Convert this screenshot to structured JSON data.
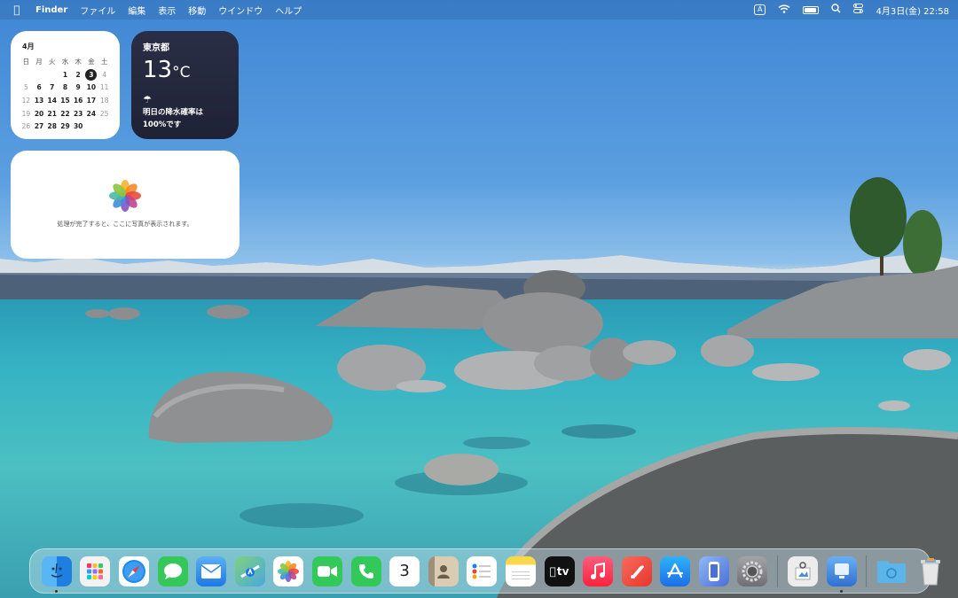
{
  "menubar": {
    "apple_icon": "apple-logo-icon",
    "app_name": "Finder",
    "menus": [
      "ファイル",
      "編集",
      "表示",
      "移動",
      "ウインドウ",
      "ヘルプ"
    ],
    "input_source": "A",
    "status_icons": [
      "wifi-icon",
      "battery-icon",
      "spotlight-icon",
      "control-center-icon"
    ],
    "clock": "4月3日(金)  22:58"
  },
  "calendar_widget": {
    "month": "4月",
    "weekdays": [
      "日",
      "月",
      "火",
      "水",
      "木",
      "金",
      "土"
    ],
    "weeks": [
      [
        "",
        "",
        "",
        "1",
        "2",
        "3",
        "4"
      ],
      [
        "5",
        "6",
        "7",
        "8",
        "9",
        "10",
        "11"
      ],
      [
        "12",
        "13",
        "14",
        "15",
        "16",
        "17",
        "18"
      ],
      [
        "19",
        "20",
        "21",
        "22",
        "23",
        "24",
        "25"
      ],
      [
        "26",
        "27",
        "28",
        "29",
        "30",
        "",
        ""
      ]
    ],
    "today": "3"
  },
  "weather_widget": {
    "location": "東京都",
    "temperature": "13",
    "unit": "°C",
    "icon": "umbrella-icon",
    "forecast_line1": "明日の降水確率は",
    "forecast_line2": "100%です"
  },
  "photos_widget": {
    "icon": "photos-icon",
    "message": "処理が完了すると、ここに写真が表示されます。"
  },
  "dock": {
    "apps": [
      {
        "name": "finder",
        "icon": "finder-icon",
        "color": "#2f8de4",
        "running": true
      },
      {
        "name": "launchpad",
        "icon": "launchpad-icon",
        "color": "#f2f2f2",
        "running": false
      },
      {
        "name": "safari",
        "icon": "safari-icon",
        "color": "#1a8cf0",
        "running": false
      },
      {
        "name": "messages",
        "icon": "messages-icon",
        "color": "#35c759",
        "running": false
      },
      {
        "name": "mail",
        "icon": "mail-icon",
        "color": "#3b95f0",
        "running": false
      },
      {
        "name": "maps",
        "icon": "maps-icon",
        "color": "#4fbf6a",
        "running": false
      },
      {
        "name": "photos",
        "icon": "photos-icon",
        "color": "#ffffff",
        "running": false
      },
      {
        "name": "facetime",
        "icon": "facetime-icon",
        "color": "#33c85a",
        "running": false
      },
      {
        "name": "phone",
        "icon": "phone-icon",
        "color": "#33c85a",
        "running": false
      },
      {
        "name": "calendar",
        "icon": "calendar-icon",
        "color": "#ffffff",
        "label": "3",
        "running": false
      },
      {
        "name": "contacts",
        "icon": "contacts-icon",
        "color": "#c8b89a",
        "running": false
      },
      {
        "name": "reminders",
        "icon": "reminders-icon",
        "color": "#ffffff",
        "running": false
      },
      {
        "name": "notes",
        "icon": "notes-icon",
        "color": "#fbd74a",
        "running": false
      },
      {
        "name": "apple-tv",
        "icon": "apple-tv-icon",
        "color": "#111111",
        "label": "tv",
        "running": false
      },
      {
        "name": "music",
        "icon": "music-icon",
        "color": "#fa3d55",
        "running": false
      },
      {
        "name": "news",
        "icon": "news-icon",
        "color": "#f0514a",
        "running": false
      },
      {
        "name": "app-store",
        "icon": "app-store-icon",
        "color": "#1b8df2",
        "running": false
      },
      {
        "name": "iphone-mirroring",
        "icon": "iphone-mirroring-icon",
        "color": "#4a6fd8",
        "running": false
      },
      {
        "name": "system-settings",
        "icon": "system-settings-icon",
        "color": "#8e8e93",
        "running": false
      },
      {
        "name": "preview",
        "icon": "preview-icon",
        "color": "#e8e8e8",
        "running": false
      },
      {
        "name": "screen-sharing",
        "icon": "screen-sharing-icon",
        "color": "#3a7bd5",
        "running": true
      },
      {
        "name": "downloads-folder",
        "icon": "folder-icon",
        "color": "#5bb5e8",
        "running": false
      },
      {
        "name": "trash",
        "icon": "trash-icon",
        "color": "#d8d8d8",
        "running": false
      }
    ]
  }
}
